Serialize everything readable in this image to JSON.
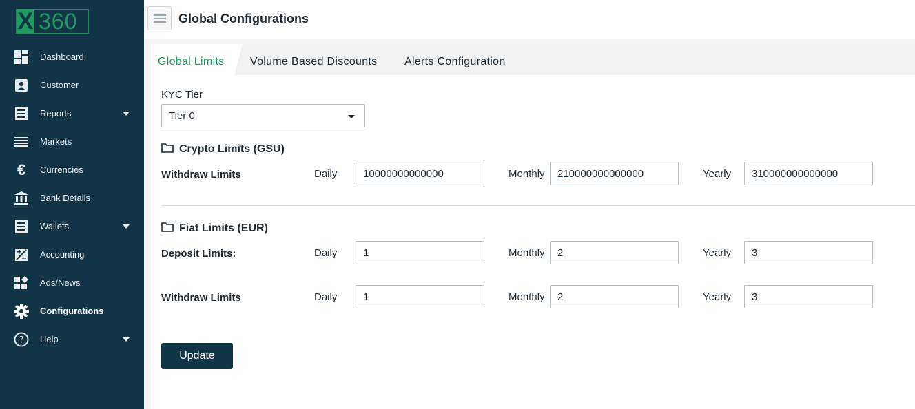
{
  "logo": {
    "x": "X",
    "num": "360"
  },
  "sidebar": {
    "items": [
      {
        "label": "Dashboard",
        "icon": "dashboard-icon"
      },
      {
        "label": "Customer",
        "icon": "customer-icon"
      },
      {
        "label": "Reports",
        "icon": "reports-icon",
        "has_caret": true
      },
      {
        "label": "Markets",
        "icon": "markets-icon"
      },
      {
        "label": "Currencies",
        "icon": "euro-icon"
      },
      {
        "label": "Bank Details",
        "icon": "bank-icon"
      },
      {
        "label": "Wallets",
        "icon": "wallets-icon",
        "has_caret": true
      },
      {
        "label": "Accounting",
        "icon": "accounting-icon"
      },
      {
        "label": "Ads/News",
        "icon": "ads-news-icon"
      },
      {
        "label": "Configurations",
        "icon": "gear-icon",
        "active": true
      },
      {
        "label": "Help",
        "icon": "help-icon",
        "has_caret": true
      }
    ]
  },
  "header": {
    "title": "Global Configurations"
  },
  "tabs": [
    {
      "label": "Global Limits",
      "active": true
    },
    {
      "label": "Volume Based Discounts"
    },
    {
      "label": "Alerts Configuration"
    }
  ],
  "kyc": {
    "label": "KYC Tier",
    "selected": "Tier 0"
  },
  "crypto": {
    "title": "Crypto Limits (GSU)",
    "withdraw": {
      "label": "Withdraw Limits",
      "daily_label": "Daily",
      "daily": "10000000000000",
      "monthly_label": "Monthly",
      "monthly": "210000000000000",
      "yearly_label": "Yearly",
      "yearly": "310000000000000"
    }
  },
  "fiat": {
    "title": "Fiat Limits (EUR)",
    "deposit": {
      "label": "Deposit Limits:",
      "daily_label": "Daily",
      "daily": "1",
      "monthly_label": "Monthly",
      "monthly": "2",
      "yearly_label": "Yearly",
      "yearly": "3"
    },
    "withdraw": {
      "label": "Withdraw Limits",
      "daily_label": "Daily",
      "daily": "1",
      "monthly_label": "Monthly",
      "monthly": "2",
      "yearly_label": "Yearly",
      "yearly": "3"
    }
  },
  "actions": {
    "update_label": "Update"
  },
  "colors": {
    "sidebar_bg": "#123645",
    "accent_green": "#1e9b60",
    "button_bg": "#123645"
  }
}
